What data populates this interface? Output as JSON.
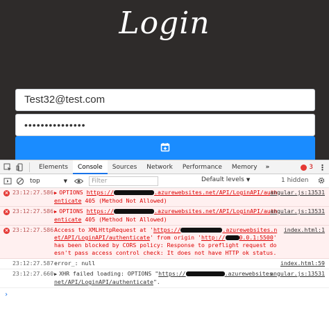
{
  "app": {
    "title": "Login",
    "email_value": "Test32@test.com",
    "password_mask": "•••••••••••••••"
  },
  "devtools": {
    "tabs": [
      "Elements",
      "Console",
      "Sources",
      "Network",
      "Performance",
      "Memory"
    ],
    "more": "»",
    "error_count": "3",
    "toolbar": {
      "context": "top",
      "filter_placeholder": "Filter",
      "levels": "Default levels",
      "hidden": "1 hidden"
    },
    "messages": [
      {
        "type": "error",
        "time": "23:12:27.586",
        "caret": "▶",
        "pre": "OPTIONS ",
        "link_a": "https://",
        "link_b": ".azurewebsites.net/API/LoginAPI/authenticate",
        "post": " 405 (Method Not Allowed)",
        "source": "angular.js:13531"
      },
      {
        "type": "error",
        "time": "23:12:27.586",
        "caret": "▶",
        "pre": "OPTIONS ",
        "link_a": "https://",
        "link_b": ".azurewebsites.net/API/LoginAPI/authenticate",
        "post": " 405 (Method Not Allowed)",
        "source": "angular.js:13531"
      },
      {
        "type": "error",
        "time": "23:12:27.586",
        "pre": "Access to XMLHttpRequest at '",
        "link_a": "https://",
        "link_b": ".azurewebsites.net/API/LoginAPI/authenticate",
        "mid": "' from origin '",
        "link_c": "http://",
        "link_d": "0.0.1:5500",
        "post": "' has been blocked by CORS policy: Response to preflight request doesn't pass access control check: It does not have HTTP ok status.",
        "source": "index.html:1"
      },
      {
        "type": "plain",
        "time": "23:12:27.587",
        "text": "error_: null",
        "source": "index.html:59"
      },
      {
        "type": "warn",
        "time": "23:12:27.660",
        "caret": "▶",
        "pre": "XHR failed loading: OPTIONS \"",
        "link_a": "https://",
        "link_b": ".azurewebsites.net/API/LoginAPI/authenticate",
        "post": "\".",
        "source": "angular.js:13531"
      }
    ],
    "prompt": "›"
  }
}
